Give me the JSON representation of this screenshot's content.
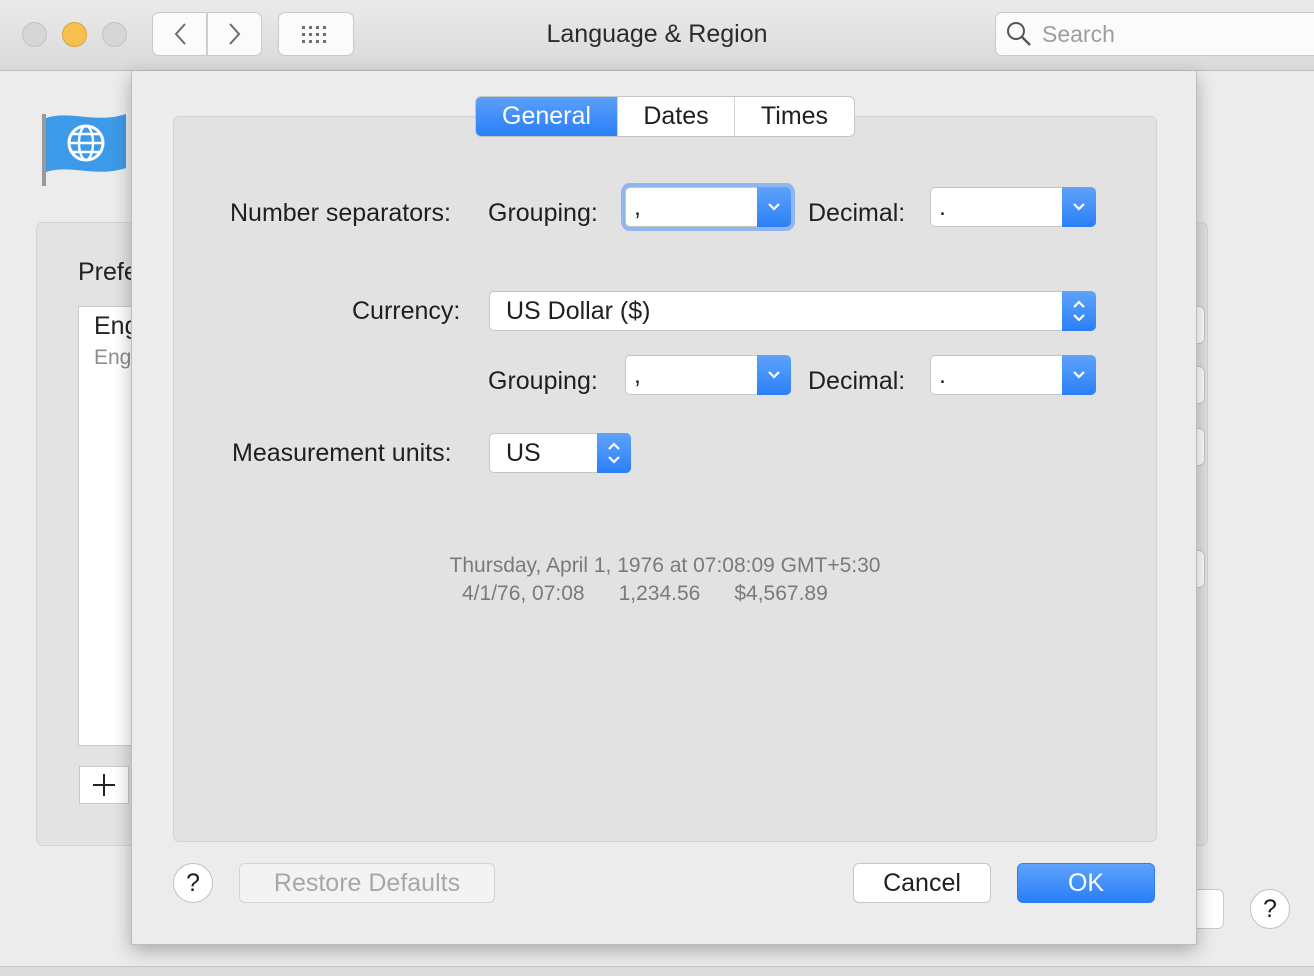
{
  "window": {
    "title": "Language & Region",
    "search_placeholder": "Search"
  },
  "background": {
    "preferred_label": "Prefe",
    "list_primary": "Eng",
    "list_secondary": "Eng",
    "add_label": "+",
    "help_label": "?"
  },
  "tabs": [
    {
      "label": "General",
      "active": true
    },
    {
      "label": "Dates",
      "active": false
    },
    {
      "label": "Times",
      "active": false
    }
  ],
  "general": {
    "number_separators_label": "Number separators:",
    "grouping_label": "Grouping:",
    "decimal_label": "Decimal:",
    "number_grouping_value": ",",
    "number_decimal_value": ".",
    "currency_label": "Currency:",
    "currency_value": "US Dollar ($)",
    "currency_grouping_label": "Grouping:",
    "currency_decimal_label": "Decimal:",
    "currency_grouping_value": ",",
    "currency_decimal_value": ".",
    "measurement_label": "Measurement units:",
    "measurement_value": "US"
  },
  "sample": {
    "line1": "Thursday, April 1, 1976 at 07:08:09 GMT+5:30",
    "date_short": "4/1/76, 07:08",
    "number": "1,234.56",
    "currency": "$4,567.89"
  },
  "footer": {
    "help_label": "?",
    "restore_label": "Restore Defaults",
    "cancel_label": "Cancel",
    "ok_label": "OK"
  },
  "colors": {
    "accent": "#2a7ef7",
    "traffic_min": "#f6bf4f"
  }
}
